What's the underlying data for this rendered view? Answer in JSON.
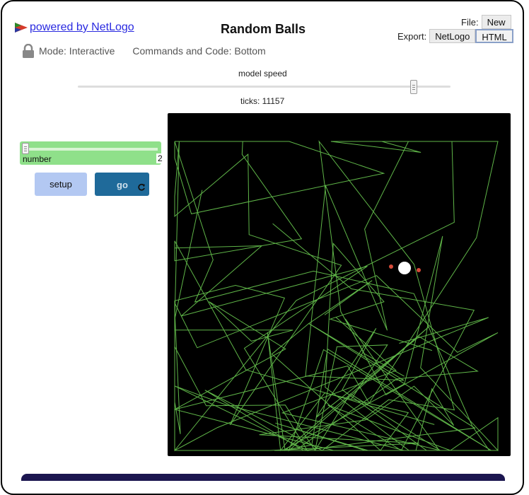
{
  "header": {
    "powered_link": "powered by NetLogo",
    "logo_icon": "netlogo-logo-icon",
    "title": "Random Balls",
    "file_label": "File:",
    "new_button": "New",
    "export_label": "Export:",
    "export_netlogo": "NetLogo",
    "export_html": "HTML"
  },
  "mode": {
    "lock_icon": "lock-icon",
    "mode_text": "Mode: Interactive",
    "code_text": "Commands and Code: Bottom"
  },
  "speed": {
    "label": "model speed",
    "value_fraction": 0.9,
    "ticks_text": "ticks: 11157"
  },
  "widgets": {
    "slider": {
      "label": "number",
      "value": "2",
      "fraction": 0.0
    },
    "setup_label": "setup",
    "go_label": "go",
    "go_forever_icon": "forever-icon"
  },
  "colors": {
    "view_bg": "#000000",
    "trail": "#5fb548",
    "ball": "#ffffff",
    "dot": "#d64b3a",
    "slider_bg": "#8fe08a",
    "setup_bg": "#b3c8f2",
    "go_bg": "#1f6a9a"
  }
}
